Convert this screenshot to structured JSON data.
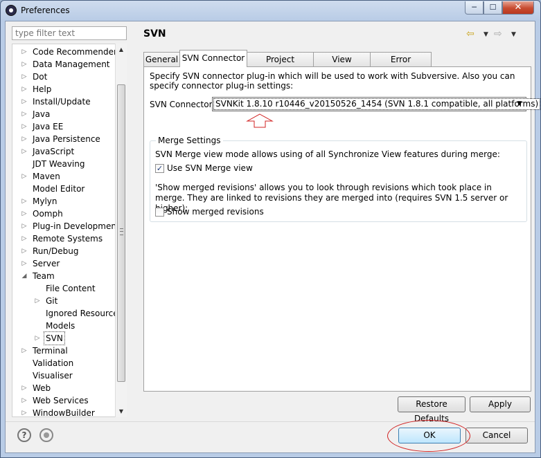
{
  "window": {
    "title": "Preferences",
    "minimize": "─",
    "maximize": "☐",
    "close": "✕"
  },
  "filter": {
    "placeholder": "type filter text"
  },
  "tree": {
    "items": [
      {
        "label": "Code Recommenders",
        "expandable": true
      },
      {
        "label": "Data Management",
        "expandable": true
      },
      {
        "label": "Dot",
        "expandable": true
      },
      {
        "label": "Help",
        "expandable": true
      },
      {
        "label": "Install/Update",
        "expandable": true
      },
      {
        "label": "Java",
        "expandable": true
      },
      {
        "label": "Java EE",
        "expandable": true
      },
      {
        "label": "Java Persistence",
        "expandable": true
      },
      {
        "label": "JavaScript",
        "expandable": true
      },
      {
        "label": "JDT Weaving",
        "expandable": false
      },
      {
        "label": "Maven",
        "expandable": true
      },
      {
        "label": "Model Editor",
        "expandable": false
      },
      {
        "label": "Mylyn",
        "expandable": true
      },
      {
        "label": "Oomph",
        "expandable": true
      },
      {
        "label": "Plug-in Development",
        "expandable": true
      },
      {
        "label": "Remote Systems",
        "expandable": true
      },
      {
        "label": "Run/Debug",
        "expandable": true
      },
      {
        "label": "Server",
        "expandable": true
      },
      {
        "label": "Team",
        "expandable": true,
        "expanded": true
      },
      {
        "label": "File Content",
        "expandable": false,
        "child": true
      },
      {
        "label": "Git",
        "expandable": true,
        "child": true
      },
      {
        "label": "Ignored Resources",
        "expandable": false,
        "child": true
      },
      {
        "label": "Models",
        "expandable": false,
        "child": true
      },
      {
        "label": "SVN",
        "expandable": true,
        "child": true,
        "selected": true
      },
      {
        "label": "Terminal",
        "expandable": true
      },
      {
        "label": "Validation",
        "expandable": false
      },
      {
        "label": "Visualiser",
        "expandable": false
      },
      {
        "label": "Web",
        "expandable": true
      },
      {
        "label": "Web Services",
        "expandable": true
      },
      {
        "label": "WindowBuilder",
        "expandable": true
      }
    ]
  },
  "page": {
    "title": "SVN"
  },
  "nav": {
    "back": "⇦",
    "forward": "⇨",
    "dropdown": "▼"
  },
  "tabs": [
    {
      "label": "General"
    },
    {
      "label": "SVN Connector",
      "active": true
    },
    {
      "label": "Project structure"
    },
    {
      "label": "View Settings"
    },
    {
      "label": "Error Reporting"
    }
  ],
  "connector": {
    "description": "Specify SVN connector plug-in which will be used to work with Subversive. Also you can specify connector plug-in settings:",
    "label": "SVN Connector:",
    "selected": "SVNKit 1.8.10 r10446_v20150526_1454 (SVN 1.8.1 compatible, all platforms)"
  },
  "merge": {
    "legend": "Merge Settings",
    "merge_view_text": "SVN Merge view mode allows using of all Synchronize View features during merge:",
    "use_merge_view_label": "Use SVN Merge view",
    "use_merge_view_checked": true,
    "merged_revisions_text": "'Show merged revisions' allows you to look through revisions which took place in merge. They are linked to revisions they are merged into (requires SVN 1.5 server or higher):",
    "show_merged_label": "Show merged revisions",
    "show_merged_checked": false
  },
  "buttons": {
    "restore": "Restore Defaults",
    "apply": "Apply",
    "ok": "OK",
    "cancel": "Cancel",
    "help": "?"
  },
  "annotation_color": "#d02020"
}
